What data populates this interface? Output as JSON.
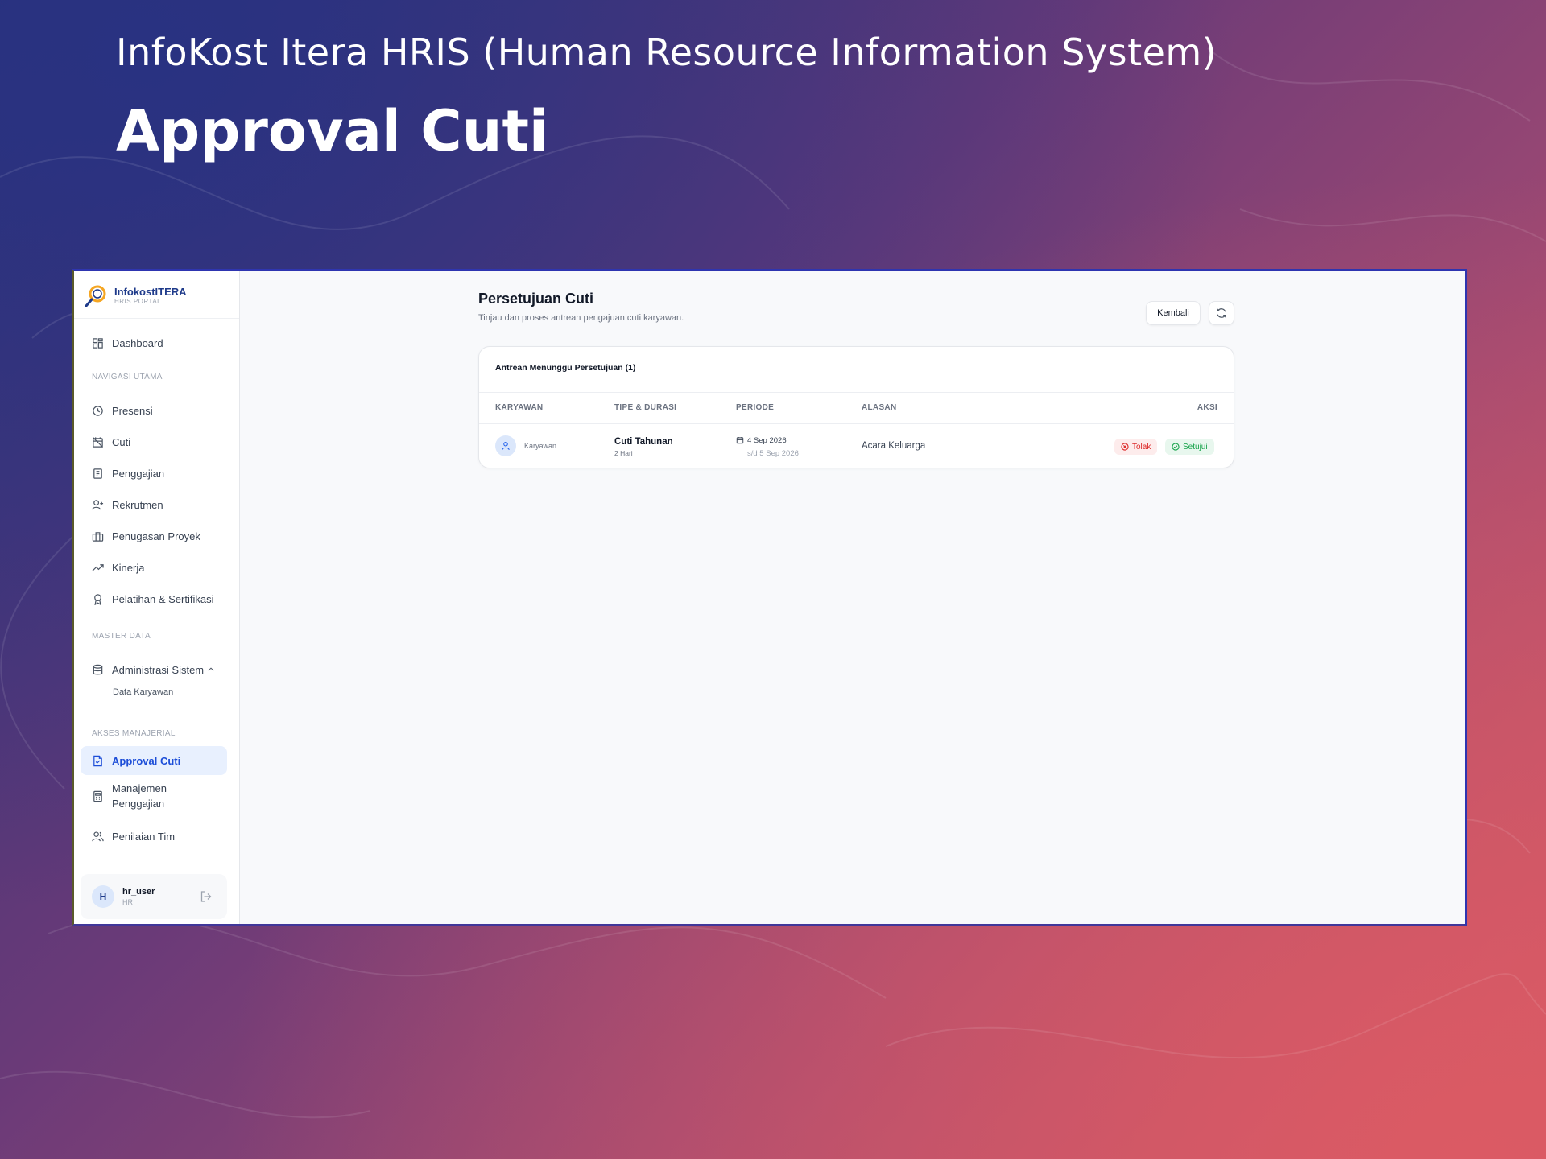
{
  "slide": {
    "subtitle": "InfoKost Itera HRIS (Human Resource Information System)",
    "title": "Approval Cuti"
  },
  "brand": {
    "name": "InfokostITERA",
    "sub": "HRIS PORTAL"
  },
  "sidebar": {
    "dashboard": "Dashboard",
    "section_main": "NAVIGASI UTAMA",
    "items_main": [
      "Presensi",
      "Cuti",
      "Penggajian",
      "Rekrutmen",
      "Penugasan Proyek",
      "Kinerja",
      "Pelatihan & Sertifikasi"
    ],
    "section_master": "MASTER DATA",
    "admin": "Administrasi Sistem",
    "admin_sub": "Data Karyawan",
    "section_manager": "AKSES MANAJERIAL",
    "approval": "Approval Cuti",
    "payroll_mgmt": "Manajemen Penggajian",
    "team_review": "Penilaian Tim"
  },
  "user": {
    "initial": "H",
    "name": "hr_user",
    "role": "HR"
  },
  "page": {
    "title": "Persetujuan Cuti",
    "description": "Tinjau dan proses antrean pengajuan cuti karyawan.",
    "back_label": "Kembali"
  },
  "queue": {
    "header": "Antrean Menunggu Persetujuan (1)",
    "columns": {
      "employee": "KARYAWAN",
      "type": "TIPE & DURASI",
      "period": "PERIODE",
      "reason": "ALASAN",
      "action": "AKSI"
    },
    "rows": [
      {
        "employee": "Karyawan",
        "type": "Cuti Tahunan",
        "duration": "2 Hari",
        "start": "4 Sep 2026",
        "end": "s/d 5 Sep 2026",
        "reason": "Acara Keluarga",
        "reject_label": "Tolak",
        "approve_label": "Setujui"
      }
    ]
  },
  "colors": {
    "accent": "#1d4ed8",
    "reject": "#dc2626",
    "approve": "#16a34a",
    "frame": "#2e35b0"
  }
}
